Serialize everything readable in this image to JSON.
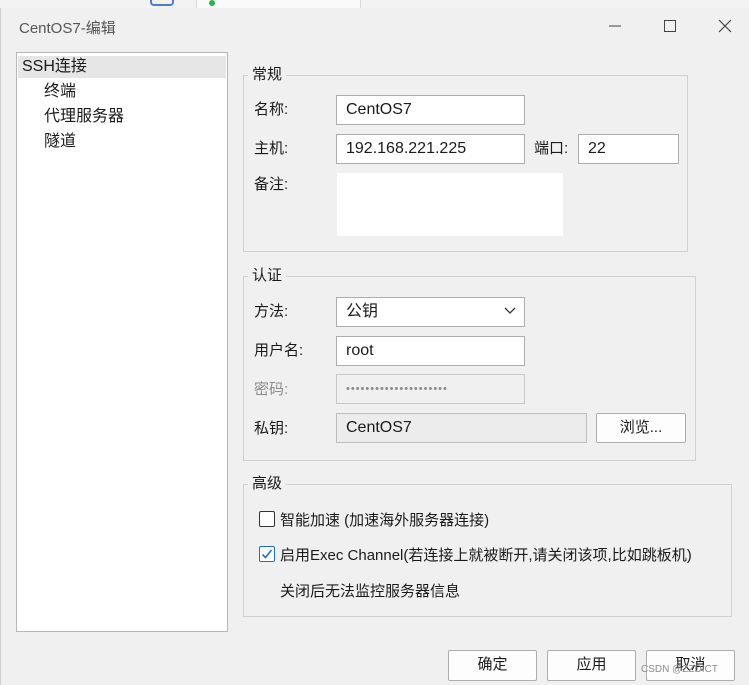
{
  "window": {
    "title": "CentOS7-编辑"
  },
  "background_tab": {
    "icon": "folder-icon",
    "status_color": "#2bb24c"
  },
  "tree": {
    "items": [
      {
        "label": "SSH连接",
        "selected": true
      },
      {
        "label": "终端",
        "selected": false
      },
      {
        "label": "代理服务器",
        "selected": false
      },
      {
        "label": "隧道",
        "selected": false
      }
    ]
  },
  "general": {
    "title": "常规",
    "name_label": "名称:",
    "name_value": "CentOS7",
    "host_label": "主机:",
    "host_value": "192.168.221.225",
    "port_label": "端口:",
    "port_value": "22",
    "note_label": "备注:",
    "note_value": ""
  },
  "auth": {
    "title": "认证",
    "method_label": "方法:",
    "method_value": "公钥",
    "user_label": "用户名:",
    "user_value": "root",
    "password_label": "密码:",
    "password_value": "•••••••••••••••••••••",
    "key_label": "私钥:",
    "key_value": "CentOS7",
    "browse_label": "浏览..."
  },
  "advanced": {
    "title": "高级",
    "smart_accel_label": "智能加速 (加速海外服务器连接)",
    "smart_accel_checked": false,
    "exec_channel_label": "启用Exec Channel(若连接上就被断开,请关闭该项,比如跳板机)",
    "exec_channel_checked": true,
    "exec_channel_note": "关闭后无法监控服务器信息"
  },
  "footer": {
    "ok_label": "确定",
    "apply_label": "应用",
    "cancel_label": "取消",
    "watermark": "CSDN @ZZDICT"
  },
  "colors": {
    "accent": "#1e6fc8",
    "selection": "#e6e6e6",
    "dialog_bg": "#f0f0f0"
  }
}
